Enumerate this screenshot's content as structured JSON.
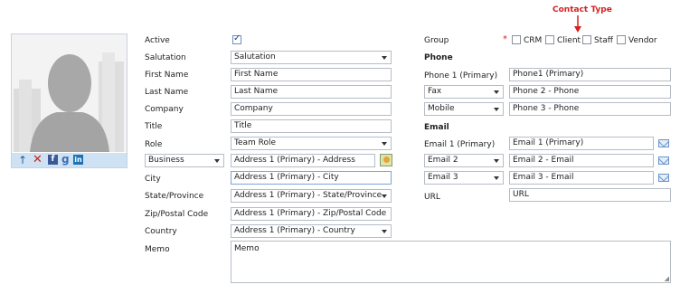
{
  "annotation": {
    "label": "Contact Type",
    "color": "#d62020"
  },
  "photo": {
    "toolbar_bg": "#cfe2f3"
  },
  "form": {
    "active_label": "Active",
    "active_checked": true,
    "salutation_label": "Salutation",
    "salutation_value": "Salutation",
    "first_name_label": "First Name",
    "first_name_value": "First Name",
    "last_name_label": "Last Name",
    "last_name_value": "Last Name",
    "company_label": "Company",
    "company_value": "Company",
    "title_label": "Title",
    "title_value": "Title",
    "role_label": "Role",
    "role_value": "Team Role",
    "address_type_value": "Business",
    "address_value": "Address 1 (Primary) - Address",
    "city_label": "City",
    "city_value": "Address 1 (Primary) - City",
    "state_label": "State/Province",
    "state_value": "Address 1 (Primary) - State/Province",
    "zip_label": "Zip/Postal Code",
    "zip_value": "Address 1 (Primary) - Zip/Postal Code",
    "country_label": "Country",
    "country_value": "Address 1 (Primary) - Country",
    "memo_label": "Memo",
    "memo_value": "Memo"
  },
  "right": {
    "group_label": "Group",
    "required_mark": "*",
    "contact_types": [
      {
        "label": "CRM",
        "checked": false
      },
      {
        "label": "Client",
        "checked": false
      },
      {
        "label": "Staff",
        "checked": false
      },
      {
        "label": "Vendor",
        "checked": false
      }
    ],
    "phone_header": "Phone",
    "phone1_label": "Phone 1 (Primary)",
    "phone1_value": "Phone1 (Primary)",
    "phone2_type": "Fax",
    "phone2_value": "Phone 2 - Phone",
    "phone3_type": "Mobile",
    "phone3_value": "Phone 3 - Phone",
    "email_header": "Email",
    "email1_label": "Email 1 (Primary)",
    "email1_value": "Email 1 (Primary)",
    "email2_type": "Email 2",
    "email2_value": "Email 2 - Email",
    "email3_type": "Email 3",
    "email3_value": "Email 3 - Email",
    "url_label": "URL",
    "url_value": "URL"
  }
}
